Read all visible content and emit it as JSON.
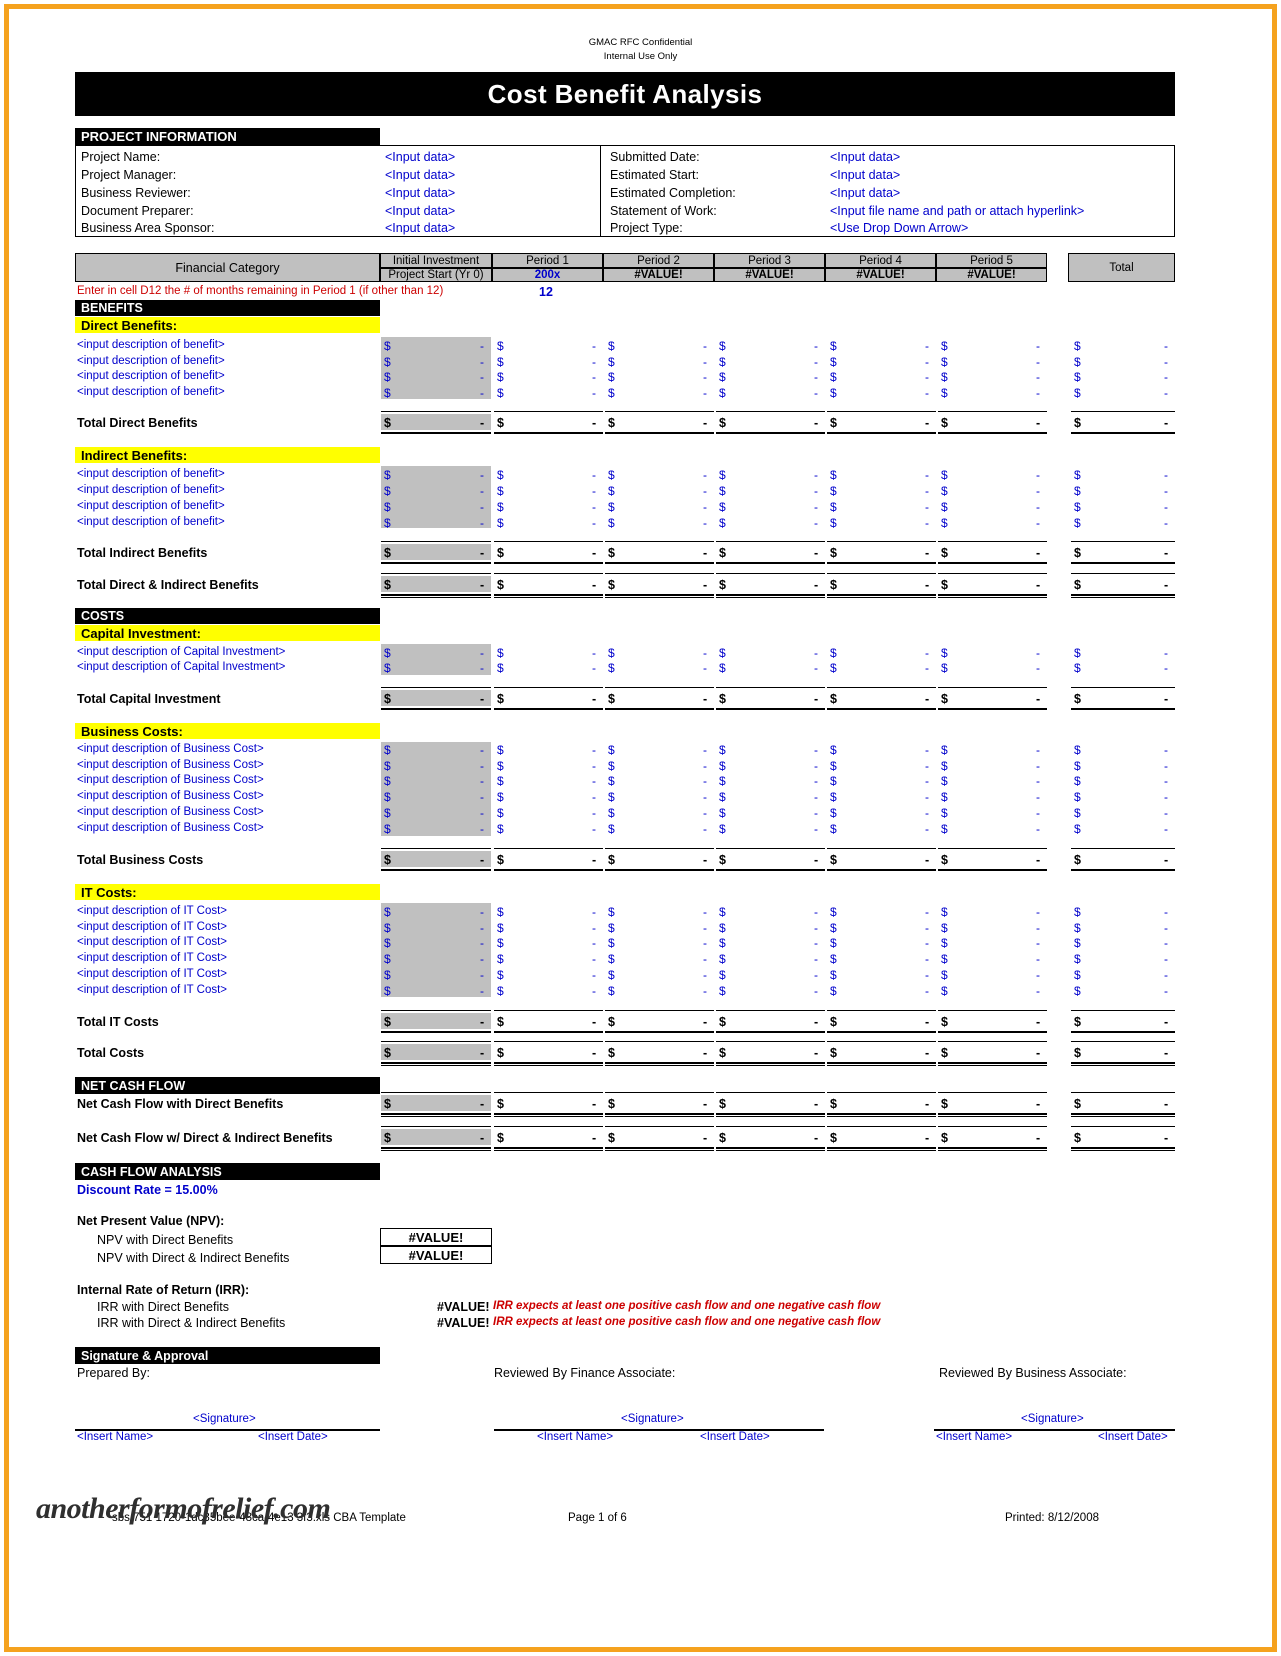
{
  "header": {
    "confidential_line1": "GMAC RFC Confidential",
    "confidential_line2": "Internal Use Only",
    "title": "Cost Benefit Analysis"
  },
  "project_information": {
    "section_title": "PROJECT INFORMATION",
    "left_fields": [
      {
        "label": "Project Name:",
        "value": "<Input data>"
      },
      {
        "label": "Project Manager:",
        "value": "<Input data>"
      },
      {
        "label": "Business Reviewer:",
        "value": "<Input data>"
      },
      {
        "label": "Document Preparer:",
        "value": "<Input data>"
      },
      {
        "label": "Business Area Sponsor:",
        "value": "<Input data>"
      }
    ],
    "right_fields": [
      {
        "label": "Submitted Date:",
        "value": "<Input data>"
      },
      {
        "label": "Estimated Start:",
        "value": "<Input data>"
      },
      {
        "label": "Estimated Completion:",
        "value": "<Input data>"
      },
      {
        "label": "Statement of Work:",
        "value": "<Input file name and path or attach hyperlink>"
      },
      {
        "label": "Project Type:",
        "value": "<Use Drop Down Arrow>"
      }
    ]
  },
  "table_header": {
    "financial_category": "Financial Category",
    "columns": [
      {
        "top": "Initial Investment",
        "bottom": "Project Start (Yr 0)"
      },
      {
        "top": "Period 1",
        "bottom": "200x"
      },
      {
        "top": "Period 2",
        "bottom": "#VALUE!"
      },
      {
        "top": "Period 3",
        "bottom": "#VALUE!"
      },
      {
        "top": "Period 4",
        "bottom": "#VALUE!"
      },
      {
        "top": "Period 5",
        "bottom": "#VALUE!"
      }
    ],
    "total": "Total"
  },
  "note": {
    "text": "Enter in cell  D12 the # of months remaining in Period 1 (if other than 12)",
    "value": "12"
  },
  "sections": {
    "benefits_title": "BENEFITS",
    "direct_benefits_title": "Direct Benefits:",
    "direct_benefits_rows": [
      "<input description of benefit>",
      "<input description of benefit>",
      "<input description of benefit>",
      "<input description of benefit>"
    ],
    "total_direct_benefits": "Total Direct Benefits",
    "indirect_benefits_title": "Indirect Benefits:",
    "indirect_benefits_rows": [
      "<input description of benefit>",
      "<input description of benefit>",
      "<input description of benefit>",
      "<input description of benefit>"
    ],
    "total_indirect_benefits": "Total Indirect Benefits",
    "total_direct_indirect_benefits": "Total Direct & Indirect Benefits",
    "costs_title": "COSTS",
    "capital_investment_title": "Capital Investment:",
    "capital_investment_rows": [
      "<input description of Capital Investment>",
      "<input description of Capital Investment>"
    ],
    "total_capital_investment": "Total Capital Investment",
    "business_costs_title": "Business Costs:",
    "business_costs_rows": [
      "<input description of Business Cost>",
      "<input description of Business Cost>",
      "<input description of Business Cost>",
      "<input description of Business Cost>",
      "<input description of Business Cost>",
      "<input description of Business Cost>"
    ],
    "total_business_costs": "Total Business Costs",
    "it_costs_title": "IT Costs:",
    "it_costs_rows": [
      "<input description of IT Cost>",
      "<input description of IT Cost>",
      "<input description of IT Cost>",
      "<input description of IT Cost>",
      "<input description of IT Cost>",
      "<input description of IT Cost>"
    ],
    "total_it_costs": "Total IT Costs",
    "total_costs": "Total Costs",
    "net_cash_flow_title": "NET CASH FLOW",
    "net_cash_flow_direct": "Net Cash Flow with Direct Benefits",
    "net_cash_flow_direct_indirect": "Net Cash Flow w/ Direct & Indirect Benefits"
  },
  "cash_flow_analysis": {
    "section_title": "CASH FLOW ANALYSIS",
    "discount_rate": "Discount Rate = 15.00%",
    "npv_heading": "Net Present Value (NPV):",
    "npv_direct_label": "NPV with Direct Benefits",
    "npv_direct_value": "#VALUE!",
    "npv_direct_indirect_label": "NPV with Direct & Indirect Benefits",
    "npv_direct_indirect_value": "#VALUE!",
    "irr_heading": "Internal Rate of Return (IRR):",
    "irr_direct_label": "IRR with Direct Benefits",
    "irr_direct_value": "#VALUE!",
    "irr_direct_note": "IRR expects at least one positive cash flow and one negative cash flow",
    "irr_direct_indirect_label": "IRR with Direct & Indirect Benefits",
    "irr_direct_indirect_value": "#VALUE!",
    "irr_direct_indirect_note": "IRR expects at least one positive cash flow and one negative cash flow"
  },
  "signature": {
    "section_title": "Signature & Approval",
    "blocks": [
      {
        "heading": "Prepared By:",
        "signature": "<Signature>",
        "name": "<Insert Name>",
        "date": "<Insert Date>"
      },
      {
        "heading": "Reviewed By Finance Associate:",
        "signature": "<Signature>",
        "name": "<Insert Name>",
        "date": "<Insert Date>"
      },
      {
        "heading": "Reviewed By Business Associate:",
        "signature": "<Signature>",
        "name": "<Insert Name>",
        "date": "<Insert Date>"
      }
    ]
  },
  "footer": {
    "filename": "sbs 751 1720-1dc35bee-48ca-4e13 3f3.xls CBA Template",
    "page": "Page 1 of 6",
    "printed": "Printed: 8/12/2008",
    "watermark": "anotherformofrelief.com"
  },
  "cells": {
    "dollar": "$",
    "dash": "-"
  }
}
